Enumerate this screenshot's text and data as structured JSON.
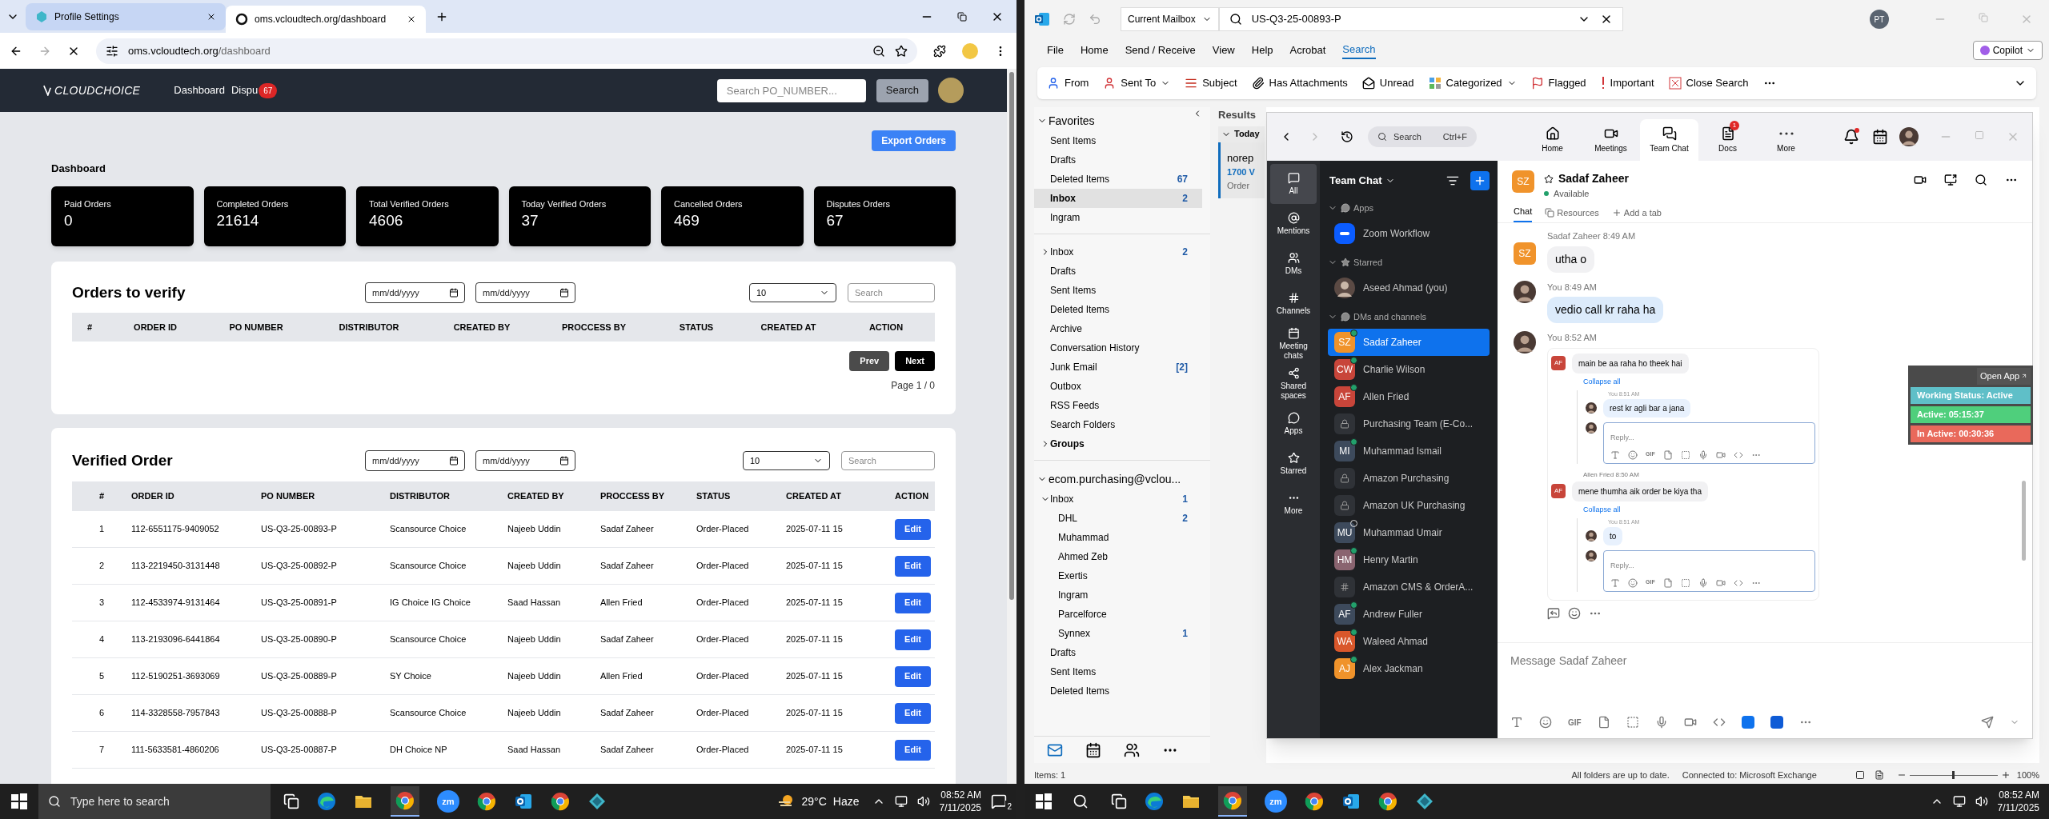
{
  "browser": {
    "tabs": [
      {
        "title": "Profile Settings",
        "selected": false
      },
      {
        "title": "oms.vcloudtech.org/dashboard",
        "selected": true
      }
    ],
    "address": {
      "host": "oms.vcloudtech.org",
      "path": "/dashboard"
    }
  },
  "oms": {
    "logo": "CLOUDCHOICE",
    "nav": [
      {
        "label": "Dashboard"
      },
      {
        "label": "Dispu",
        "badge": "67"
      }
    ],
    "search": {
      "placeholder": "Search PO_NUMBER...",
      "button": "Search"
    },
    "export_button": "Export Orders",
    "heading": "Dashboard",
    "stats": [
      {
        "label": "Paid Orders",
        "value": "0"
      },
      {
        "label": "Completed Orders",
        "value": "21614"
      },
      {
        "label": "Total Verified Orders",
        "value": "4606"
      },
      {
        "label": "Today Verified Orders",
        "value": "37"
      },
      {
        "label": "Cancelled Orders",
        "value": "469"
      },
      {
        "label": "Disputes Orders",
        "value": "67"
      }
    ],
    "orders_to_verify": {
      "title": "Orders to verify",
      "date_placeholders": [
        "mm/dd/yyyy",
        "mm/dd/yyyy"
      ],
      "page_size": "10",
      "search_placeholder": "Search",
      "columns": [
        "#",
        "ORDER ID",
        "PO NUMBER",
        "DISTRIBUTOR",
        "CREATED BY",
        "PROCCESS BY",
        "STATUS",
        "CREATED AT",
        "ACTION"
      ],
      "prev": "Prev",
      "next": "Next",
      "page": "Page 1 / 0"
    },
    "verified_order": {
      "title": "Verified Order",
      "date_placeholders": [
        "mm/dd/yyyy",
        "mm/dd/yyyy"
      ],
      "page_size": "10",
      "search_placeholder": "Search",
      "columns": [
        "#",
        "ORDER ID",
        "PO NUMBER",
        "DISTRIBUTOR",
        "CREATED BY",
        "PROCCESS BY",
        "STATUS",
        "CREATED AT",
        "ACTION"
      ],
      "rows": [
        [
          "1",
          "112-6551175-9409052",
          "US-Q3-25-00893-P",
          "Scansource Choice",
          "Najeeb Uddin",
          "Sadaf Zaheer",
          "Order-Placed",
          "2025-07-11 15",
          "Edit"
        ],
        [
          "2",
          "113-2219450-3131448",
          "US-Q3-25-00892-P",
          "Scansource Choice",
          "Najeeb Uddin",
          "Sadaf Zaheer",
          "Order-Placed",
          "2025-07-11 15",
          "Edit"
        ],
        [
          "3",
          "112-4533974-9131464",
          "US-Q3-25-00891-P",
          "IG Choice IG Choice",
          "Saad Hassan",
          "Allen Fried",
          "Order-Placed",
          "2025-07-11 15",
          "Edit"
        ],
        [
          "4",
          "113-2193096-6441864",
          "US-Q3-25-00890-P",
          "Scansource Choice",
          "Najeeb Uddin",
          "Sadaf Zaheer",
          "Order-Placed",
          "2025-07-11 15",
          "Edit"
        ],
        [
          "5",
          "112-5190251-3693069",
          "US-Q3-25-00889-P",
          "SY Choice",
          "Najeeb Uddin",
          "Allen Fried",
          "Order-Placed",
          "2025-07-11 15",
          "Edit"
        ],
        [
          "6",
          "114-3328558-7957843",
          "US-Q3-25-00888-P",
          "Scansource Choice",
          "Najeeb Uddin",
          "Sadaf Zaheer",
          "Order-Placed",
          "2025-07-11 15",
          "Edit"
        ],
        [
          "7",
          "111-5633581-4860206",
          "US-Q3-25-00887-P",
          "DH Choice NP",
          "Saad Hassan",
          "Sadaf Zaheer",
          "Order-Placed",
          "2025-07-11 15",
          "Edit"
        ]
      ]
    }
  },
  "left_taskbar": {
    "search_placeholder": "Type here to search",
    "zoom_label": "zm",
    "temperature": "29°C",
    "weather": "Haze",
    "time": "08:52 AM",
    "date": "7/11/2025",
    "notifications": "2"
  },
  "outlook": {
    "scope": "Current Mailbox",
    "search_value": "US-Q3-25-00893-P",
    "profile_initials": "PT",
    "menu": [
      {
        "label": "File",
        "selected": false
      },
      {
        "label": "Home",
        "selected": false
      },
      {
        "label": "Send / Receive",
        "selected": false
      },
      {
        "label": "View",
        "selected": false
      },
      {
        "label": "Help",
        "selected": false
      },
      {
        "label": "Acrobat",
        "selected": false
      },
      {
        "label": "Search",
        "selected": true
      }
    ],
    "copilot": "Copilot",
    "ribbon": [
      {
        "kind": "from",
        "label": "From"
      },
      {
        "kind": "sent_to",
        "label": "Sent To",
        "dropdown": true
      },
      {
        "kind": "subject",
        "label": "Subject"
      },
      {
        "kind": "attach",
        "label": "Has Attachments"
      },
      {
        "kind": "unread",
        "label": "Unread"
      },
      {
        "kind": "categorized",
        "label": "Categorized",
        "dropdown": true
      },
      {
        "kind": "flagged",
        "label": "Flagged"
      },
      {
        "kind": "important",
        "label": "Important"
      },
      {
        "kind": "close",
        "label": "Close Search"
      }
    ],
    "folder_sections": [
      {
        "label": "Favorites",
        "expanded": true,
        "children": [
          {
            "label": "Sent Items",
            "selected": false
          },
          {
            "label": "Drafts",
            "selected": false
          },
          {
            "label": "Deleted Items",
            "count": "67",
            "selected": false
          },
          {
            "label": "Inbox",
            "count": "2",
            "selected": true
          },
          {
            "label": "Ingram",
            "selected": false
          }
        ]
      },
      {
        "children": [
          {
            "label": "Inbox",
            "count": "2",
            "expanded": false,
            "selected": false
          },
          {
            "label": "Drafts",
            "selected": false
          },
          {
            "label": "Sent Items",
            "selected": false
          },
          {
            "label": "Deleted Items",
            "selected": false
          },
          {
            "label": "Archive",
            "selected": false
          },
          {
            "label": "Conversation History",
            "selected": false
          },
          {
            "label": "Junk Email",
            "count": "[2]",
            "selected": false
          },
          {
            "label": "Outbox",
            "selected": false
          },
          {
            "label": "RSS Feeds",
            "selected": false
          },
          {
            "label": "Search Folders",
            "selected": false
          },
          {
            "label": "Groups",
            "expanded": false,
            "selected": false
          }
        ]
      },
      {
        "label": "ecom.purchasing@vclou...",
        "expanded": true,
        "children": [
          {
            "label": "Inbox",
            "count": "1",
            "expanded": true,
            "selected": false,
            "children": [
              {
                "label": "DHL",
                "count": "2",
                "selected": false
              },
              {
                "label": "Muhammad",
                "selected": false
              },
              {
                "label": "Ahmed Zeb",
                "selected": false
              },
              {
                "label": "Exertis",
                "selected": false
              },
              {
                "label": "Ingram",
                "selected": false
              },
              {
                "label": "Parcelforce",
                "selected": false
              },
              {
                "label": "Synnex",
                "count": "1",
                "selected": false
              }
            ]
          },
          {
            "label": "Drafts",
            "selected": false
          },
          {
            "label": "Sent Items",
            "selected": false
          },
          {
            "label": "Deleted Items",
            "selected": false
          }
        ]
      }
    ],
    "mail_list": {
      "header": "Results",
      "group": "Today",
      "items": [
        {
          "sender": "norep",
          "subject": "1700 V",
          "preview": "Order",
          "selected": true
        }
      ]
    },
    "status_bar": {
      "items": "Items: 1",
      "sync": "All folders are up to date.",
      "connection": "Connected to: Microsoft Exchange",
      "zoom": "100%",
      "zoom_slider": {
        "level": 0.5
      }
    }
  },
  "zoom": {
    "search": "Search",
    "shortcut": "Ctrl+F",
    "top_tabs": [
      {
        "kind": "home",
        "label": "Home",
        "selected": false
      },
      {
        "kind": "meetings",
        "label": "Meetings",
        "selected": false
      },
      {
        "kind": "chat",
        "label": "Team Chat",
        "selected": true
      },
      {
        "kind": "docs",
        "label": "Docs",
        "badge": "1",
        "selected": false
      },
      {
        "kind": "more",
        "label": "More",
        "selected": false
      }
    ],
    "side_nav": [
      {
        "kind": "all",
        "label": "All",
        "selected": true
      },
      {
        "kind": "mentions",
        "label": "Mentions",
        "selected": false
      },
      {
        "kind": "dms",
        "label": "DMs",
        "selected": false
      },
      {
        "kind": "channels",
        "label": "Channels",
        "selected": false
      },
      {
        "kind": "meeting_chats",
        "label": "Meeting chats",
        "selected": false
      },
      {
        "kind": "shared",
        "label": "Shared spaces",
        "selected": false
      },
      {
        "kind": "apps",
        "label": "Apps",
        "selected": false
      },
      {
        "kind": "starred",
        "label": "Starred",
        "selected": false
      },
      {
        "kind": "more",
        "label": "More",
        "selected": false
      }
    ],
    "panel_title": "Team Chat",
    "sections": [
      {
        "kind": "apps",
        "label": "Apps",
        "expanded": true,
        "items": [
          {
            "kind": "app",
            "name": "Zoom Workflow",
            "selected": false
          }
        ]
      },
      {
        "kind": "starred",
        "label": "Starred",
        "expanded": true,
        "items": [
          {
            "kind": "photo",
            "name": "Aseed Ahmad (you)",
            "selected": false
          }
        ]
      },
      {
        "kind": "dms",
        "label": "DMs and channels",
        "expanded": true,
        "items": [
          {
            "kind": "person",
            "name": "Sadaf Zaheer",
            "initials": "SZ",
            "color": "#f0932b",
            "online": true,
            "selected": true
          },
          {
            "kind": "person",
            "name": "Charlie Wilson",
            "initials": "CW",
            "color": "#c8453a",
            "online": true,
            "selected": false
          },
          {
            "kind": "person",
            "name": "Allen Fried",
            "initials": "AF",
            "color": "#c8453a",
            "online": true,
            "selected": false
          },
          {
            "kind": "private",
            "name": "Purchasing Team (E-Co...",
            "selected": false
          },
          {
            "kind": "person",
            "name": "Muhammad Ismail",
            "initials": "MI",
            "color": "#3d4a5c",
            "online": true,
            "selected": false
          },
          {
            "kind": "private",
            "name": "Amazon Purchasing",
            "selected": false
          },
          {
            "kind": "private",
            "name": "Amazon UK Purchasing",
            "selected": false
          },
          {
            "kind": "person",
            "name": "Muhammad Umair",
            "initials": "MU",
            "color": "#3d4a5c",
            "online": false,
            "selected": false
          },
          {
            "kind": "person",
            "name": "Henry Martin",
            "initials": "HM",
            "color": "#8a6470",
            "online": true,
            "selected": false
          },
          {
            "kind": "channel",
            "name": "Amazon CMS & OrderA...",
            "selected": false
          },
          {
            "kind": "person",
            "name": "Andrew Fuller",
            "initials": "AF",
            "color": "#3d4a5c",
            "online": true,
            "selected": false
          },
          {
            "kind": "person",
            "name": "Waleed Ahmad",
            "initials": "WA",
            "color": "#d9572b",
            "online": true,
            "selected": false
          },
          {
            "kind": "person",
            "name": "Alex Jackman",
            "initials": "AJ",
            "color": "#f0932b",
            "online": true,
            "selected": false
          }
        ]
      }
    ],
    "chat": {
      "name": "Sadaf Zaheer",
      "initials": "SZ",
      "status": "Available",
      "tabs": [
        {
          "label": "Chat",
          "selected": true
        },
        {
          "label": "Resources",
          "selected": false
        },
        {
          "label": "Add a tab",
          "selected": false
        }
      ],
      "messages": [
        {
          "kind": "text",
          "sender": "Sadaf Zaheer",
          "sender_initials": "SZ",
          "time": "8:49 AM",
          "mine": false,
          "text": "utha o"
        },
        {
          "kind": "text",
          "sender": "You",
          "time": "8:49 AM",
          "mine": true,
          "text": "vedio call kr raha ha"
        },
        {
          "kind": "thread",
          "sender": "You",
          "time": "8:52 AM",
          "mine": true,
          "threads": [
            {
              "initials": "AF",
              "text": "main be aa raha ho theek hai",
              "collapse": "Collapse all",
              "replies": [
                {
                  "sender": "You",
                  "time": "8:51 AM",
                  "text": "rest kr agli bar a jana"
                }
              ],
              "reply_placeholder": "Reply...",
              "gif": "GIF"
            },
            {
              "initials": "AF",
              "sender": "Allen Fried",
              "time": "8:50 AM",
              "text": "mene thumha aik order be kiya tha",
              "collapse": "Collapse all",
              "replies": [
                {
                  "sender": "You",
                  "time": "8:51 AM",
                  "text": "to"
                }
              ],
              "reply_placeholder": "Reply...",
              "gif": "GIF"
            }
          ]
        }
      ],
      "composer_placeholder": "Message Sadaf Zaheer",
      "composer_gif": "GIF"
    }
  },
  "status_widget": {
    "open_app": "Open App",
    "rows": [
      {
        "text": "Working Status: Active",
        "color": "#5fbfc8"
      },
      {
        "text": "Active: 05:15:37",
        "color": "#4fcf7c"
      },
      {
        "text": "In Active: 00:30:36",
        "color": "#e9695b"
      }
    ]
  },
  "right_taskbar": {
    "zoom_label": "zm",
    "time": "08:52 AM",
    "date": "7/11/2025"
  }
}
